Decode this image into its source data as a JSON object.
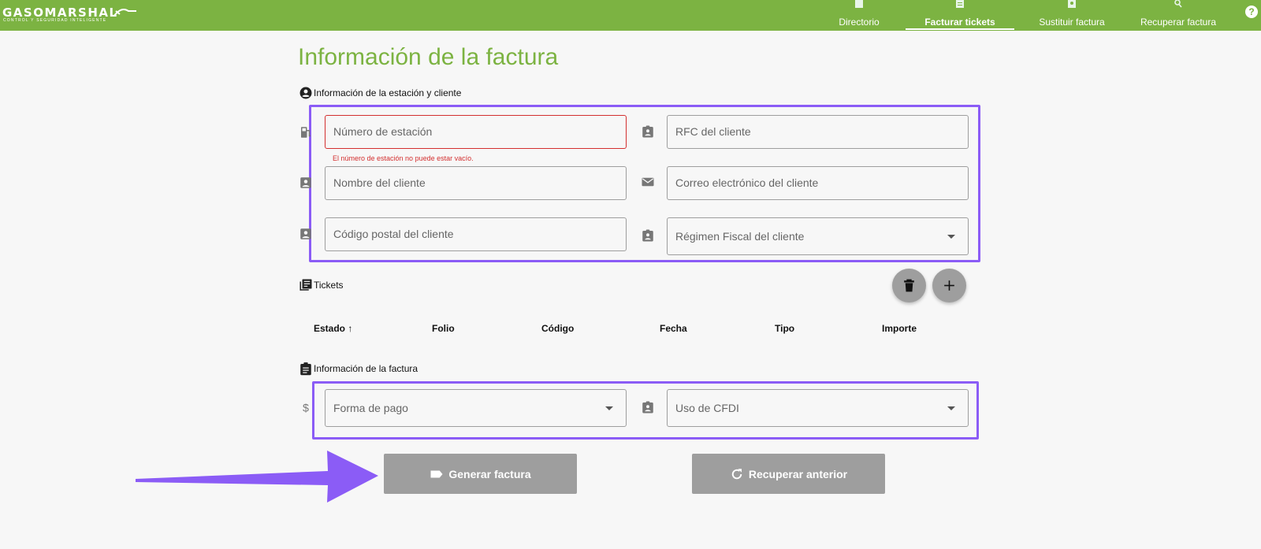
{
  "brand": {
    "name": "GASOMARSHAL",
    "tagline": "CONTROL Y SEGURIDAD INTELIGENTE"
  },
  "nav": {
    "items": [
      {
        "label": "Directorio",
        "icon": "book-icon"
      },
      {
        "label": "Facturar tickets",
        "icon": "receipt-icon",
        "active": true
      },
      {
        "label": "Sustituir factura",
        "icon": "account-box-icon"
      },
      {
        "label": "Recuperar factura",
        "icon": "search-icon"
      }
    ],
    "help": "?"
  },
  "page": {
    "title": "Información de la factura"
  },
  "client_section": {
    "heading": "Información de la estación y cliente",
    "fields": {
      "station_number": {
        "placeholder": "Número de estación",
        "error": "El número de estación no puede estar vacío."
      },
      "client_rfc": {
        "placeholder": "RFC del cliente"
      },
      "client_name": {
        "placeholder": "Nombre del cliente"
      },
      "client_email": {
        "placeholder": "Correo electrónico del cliente"
      },
      "client_postal_code": {
        "placeholder": "Código postal del cliente"
      },
      "tax_regime": {
        "placeholder": "Régimen Fiscal del cliente"
      }
    }
  },
  "tickets_section": {
    "heading": "Tickets",
    "columns": [
      "Estado",
      "Folio",
      "Código",
      "Fecha",
      "Tipo",
      "Importe"
    ],
    "sort_indicator": "↑"
  },
  "invoice_section": {
    "heading": "Información de la factura",
    "fields": {
      "payment_method": {
        "placeholder": "Forma de pago"
      },
      "cfdi_use": {
        "placeholder": "Uso de CFDI"
      }
    }
  },
  "actions": {
    "generate": "Generar factura",
    "recover": "Recuperar anterior"
  },
  "colors": {
    "brand": "#7cb342",
    "highlight": "#8b5cf6",
    "error": "#d32f2f",
    "disabled_button": "#9e9e9e"
  }
}
